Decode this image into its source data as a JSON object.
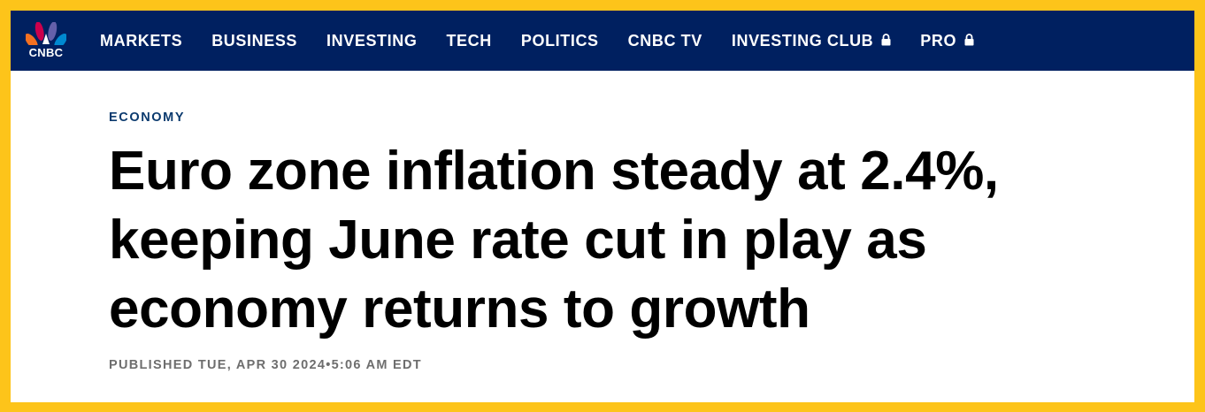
{
  "brand": {
    "logo_text": "CNBC",
    "peacock_colors": [
      "#fcb711",
      "#f37021",
      "#cc004c",
      "#6460aa",
      "#0089d0",
      "#0db14b"
    ]
  },
  "nav": {
    "items": [
      {
        "label": "MARKETS",
        "locked": false
      },
      {
        "label": "BUSINESS",
        "locked": false
      },
      {
        "label": "INVESTING",
        "locked": false
      },
      {
        "label": "TECH",
        "locked": false
      },
      {
        "label": "POLITICS",
        "locked": false
      },
      {
        "label": "CNBC TV",
        "locked": false
      },
      {
        "label": "INVESTING CLUB",
        "locked": true,
        "icon": "lock-icon"
      },
      {
        "label": "PRO",
        "locked": true,
        "icon": "lock-icon"
      }
    ]
  },
  "article": {
    "section": "ECONOMY",
    "headline": "Euro zone inflation steady at 2.4%, keeping June rate cut in play as economy returns to growth",
    "published": "PUBLISHED TUE, APR 30 2024•5:06 AM EDT"
  },
  "colors": {
    "frame_border": "#fdc41a",
    "nav_background": "#002060",
    "section_color": "#0b3a6e"
  }
}
